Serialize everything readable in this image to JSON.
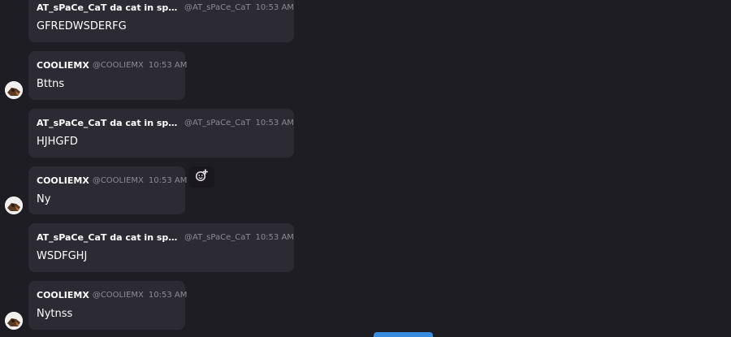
{
  "messages": [
    {
      "author": "AT_sPaCe_CaT da cat in space ...",
      "handle": "@AT_sPaCe_CaT",
      "time": "10:53 AM",
      "text": "GFREDWSDERFG"
    },
    {
      "author": "COOLIEMX",
      "handle": "@COOLIEMX",
      "time": "10:53 AM",
      "text": "Bttns"
    },
    {
      "author": "AT_sPaCe_CaT da cat in space ...",
      "handle": "@AT_sPaCe_CaT",
      "time": "10:53 AM",
      "text": "HJHGFD"
    },
    {
      "author": "COOLIEMX",
      "handle": "@COOLIEMX",
      "time": "10:53 AM",
      "text": "Ny"
    },
    {
      "author": "AT_sPaCe_CaT da cat in space ...",
      "handle": "@AT_sPaCe_CaT",
      "time": "10:53 AM",
      "text": "WSDFGHJ"
    },
    {
      "author": "COOLIEMX",
      "handle": "@COOLIEMX",
      "time": "10:53 AM",
      "text": "Nytnss"
    }
  ],
  "icons": {
    "reaction": "add-reaction-icon",
    "avatar": "user-avatar-icon"
  },
  "colors": {
    "background": "#1f1d24",
    "bubble": "#2c2a32",
    "muted_text": "#8c8a93",
    "accent": "#3a8dde"
  }
}
